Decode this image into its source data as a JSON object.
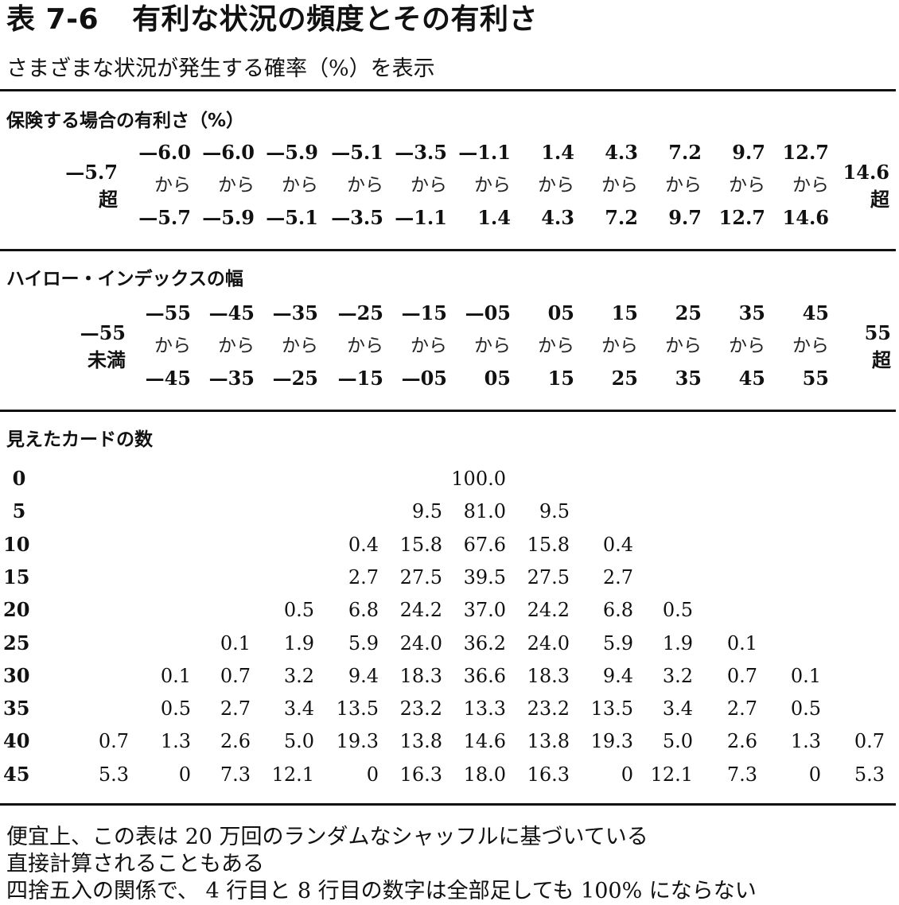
{
  "title": {
    "number": "表 7-6",
    "text": "有利な状況の頻度とその有利さ"
  },
  "subtitle": "さまざまな状況が発生する確率（%）を表示",
  "sections": {
    "advantage": {
      "heading": "保険する場合の有利さ（%）",
      "left_edge": {
        "value": "—5.7",
        "suffix": "超"
      },
      "right_edge": {
        "value": "14.6",
        "suffix": "超"
      },
      "from": [
        "—6.0",
        "—6.0",
        "—5.9",
        "—5.1",
        "—3.5",
        "—1.1",
        "1.4",
        "4.3",
        "7.2",
        "9.7",
        "12.7"
      ],
      "kara": [
        "から",
        "から",
        "から",
        "から",
        "から",
        "から",
        "から",
        "から",
        "から",
        "から",
        "から"
      ],
      "to": [
        "—5.7",
        "—5.9",
        "—5.1",
        "—3.5",
        "—1.1",
        "1.4",
        "4.3",
        "7.2",
        "9.7",
        "12.7",
        "14.6"
      ]
    },
    "hilo": {
      "heading": "ハイロー・インデックスの幅",
      "left_edge": {
        "value": "—55",
        "suffix": "未満"
      },
      "right_edge": {
        "value": "55",
        "suffix": "超"
      },
      "from": [
        "—55",
        "—45",
        "—35",
        "—25",
        "—15",
        "—05",
        "05",
        "15",
        "25",
        "35",
        "45"
      ],
      "kara": [
        "から",
        "から",
        "から",
        "から",
        "から",
        "から",
        "から",
        "から",
        "から",
        "から",
        "から"
      ],
      "to": [
        "—45",
        "—35",
        "—25",
        "—15",
        "—05",
        "05",
        "15",
        "25",
        "35",
        "45",
        "55"
      ]
    },
    "cards_seen": {
      "heading": "見えたカードの数",
      "rows": [
        {
          "label": "0",
          "values": [
            "",
            "",
            "",
            "",
            "",
            "",
            "",
            "100.0",
            "",
            "",
            "",
            "",
            "",
            ""
          ]
        },
        {
          "label": "5",
          "values": [
            "",
            "",
            "",
            "",
            "",
            "",
            "9.5",
            "81.0",
            "9.5",
            "",
            "",
            "",
            "",
            ""
          ]
        },
        {
          "label": "10",
          "values": [
            "",
            "",
            "",
            "",
            "",
            "0.4",
            "15.8",
            "67.6",
            "15.8",
            "0.4",
            "",
            "",
            "",
            ""
          ]
        },
        {
          "label": "15",
          "values": [
            "",
            "",
            "",
            "",
            "",
            "2.7",
            "27.5",
            "39.5",
            "27.5",
            "2.7",
            "",
            "",
            "",
            ""
          ]
        },
        {
          "label": "20",
          "values": [
            "",
            "",
            "",
            "",
            "0.5",
            "6.8",
            "24.2",
            "37.0",
            "24.2",
            "6.8",
            "0.5",
            "",
            "",
            ""
          ]
        },
        {
          "label": "25",
          "values": [
            "",
            "",
            "",
            "0.1",
            "1.9",
            "5.9",
            "24.0",
            "36.2",
            "24.0",
            "5.9",
            "1.9",
            "0.1",
            "",
            ""
          ]
        },
        {
          "label": "30",
          "values": [
            "",
            "",
            "0.1",
            "0.7",
            "3.2",
            "9.4",
            "18.3",
            "36.6",
            "18.3",
            "9.4",
            "3.2",
            "0.7",
            "0.1",
            ""
          ]
        },
        {
          "label": "35",
          "values": [
            "",
            "",
            "0.5",
            "2.7",
            "3.4",
            "13.5",
            "23.2",
            "13.3",
            "23.2",
            "13.5",
            "3.4",
            "2.7",
            "0.5",
            ""
          ]
        },
        {
          "label": "40",
          "values": [
            "",
            "0.7",
            "1.3",
            "2.6",
            "5.0",
            "19.3",
            "13.8",
            "14.6",
            "13.8",
            "19.3",
            "5.0",
            "2.6",
            "1.3",
            "0.7"
          ]
        },
        {
          "label": "45",
          "values": [
            "",
            "5.3",
            "0",
            "7.3",
            "12.1",
            "0",
            "16.3",
            "18.0",
            "16.3",
            "0",
            "12.1",
            "7.3",
            "0",
            "5.3"
          ]
        }
      ]
    }
  },
  "notes": [
    "便宜上、この表は 20 万回のランダムなシャッフルに基づいている",
    "直接計算されることもある",
    "四捨五入の関係で、 4 行目と 8 行目の数字は全部足しても 100% にならない"
  ]
}
